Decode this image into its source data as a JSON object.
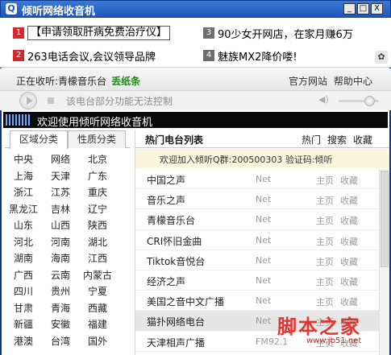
{
  "window": {
    "title": "倾听网络收音机",
    "icon": "q-icon",
    "minimize_label": "_",
    "maximize_label": "□",
    "close_label": "X"
  },
  "ads": [
    {
      "num": "1",
      "text": "【申请领取肝病免费治疗仪】",
      "num_color": "#d9262a",
      "boxed": true
    },
    {
      "num": "3",
      "text": "90少女开网店，在家月赚6万",
      "num_color": "#6e6e6e",
      "boxed": false
    },
    {
      "num": "2",
      "text": "263电话会议,会议领导品牌",
      "num_color": "#d9262a",
      "boxed": false
    },
    {
      "num": "4",
      "text": "魅族MX2降价喽!",
      "num_color": "#6e6e6e",
      "boxed": false
    }
  ],
  "now_playing": {
    "label": "正在收听:",
    "station": "青檬音乐台",
    "status": "丢纸条",
    "official_site": "官方网站",
    "help_center": "帮助中心"
  },
  "controls": {
    "message": "该电台部分功能无法控制",
    "volume_level": 0.7
  },
  "welcome": "欢迎使用倾听网络收音机",
  "left_tabs": [
    {
      "label": "区域分类",
      "active": true
    },
    {
      "label": "性质分类",
      "active": false
    }
  ],
  "regions": [
    [
      "中央",
      "网络",
      "北京"
    ],
    [
      "上海",
      "天津",
      "广东"
    ],
    [
      "浙江",
      "江苏",
      "重庆"
    ],
    [
      "黑龙江",
      "吉林",
      "辽宁"
    ],
    [
      "山东",
      "山西",
      "陕西"
    ],
    [
      "河北",
      "河南",
      "湖北"
    ],
    [
      "湖南",
      "海南",
      "江西"
    ],
    [
      "广西",
      "云南",
      "内蒙古"
    ],
    [
      "四川",
      "贵州",
      "宁夏"
    ],
    [
      "甘肃",
      "青海",
      "西藏"
    ],
    [
      "新疆",
      "安徽",
      "福建"
    ],
    [
      "港澳",
      "台湾",
      "国外"
    ]
  ],
  "list": {
    "title": "热门电台列表",
    "links": [
      "热门",
      "搜索",
      "收藏"
    ],
    "notice": "欢迎加入倾听Q群:200500303   验证码:倾听",
    "rows": [
      {
        "name": "中国之声",
        "source": "Net",
        "home": "主页",
        "fav": "收藏"
      },
      {
        "name": "音乐之声",
        "source": "Net",
        "home": "主页",
        "fav": "收藏"
      },
      {
        "name": "青檬音乐台",
        "source": "Net",
        "home": "主页",
        "fav": "收藏"
      },
      {
        "name": "CRI怀旧金曲",
        "source": "Net",
        "home": "主页",
        "fav": "收藏"
      },
      {
        "name": "Tiktok音悦台",
        "source": "Net",
        "home": "主页",
        "fav": "收藏"
      },
      {
        "name": "经济之声",
        "source": "Net",
        "home": "主页",
        "fav": "收藏"
      },
      {
        "name": "美国之音中文广播",
        "source": "Net",
        "home": "主页",
        "fav": "收藏"
      },
      {
        "name": "猫扑网络电台",
        "source": "Net",
        "home": "主页",
        "fav": "收藏"
      },
      {
        "name": "天津相声广播",
        "source": "FM92.1",
        "home": "主页",
        "fav": "收藏"
      }
    ]
  },
  "watermark": {
    "main": "脚本之家",
    "sub": "www.jb51.net"
  }
}
